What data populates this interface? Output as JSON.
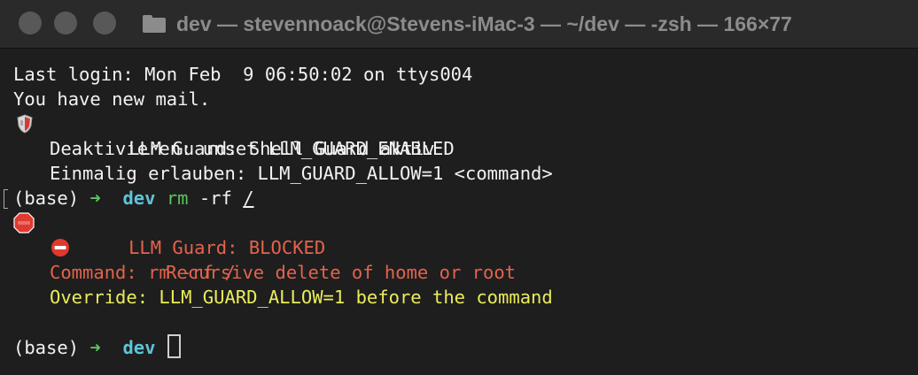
{
  "window": {
    "title": "dev — stevennoack@Stevens-iMac-3 — ~/dev — -zsh — 166×77",
    "controls": [
      "close",
      "minimize",
      "zoom"
    ],
    "title_icon": "folder-icon"
  },
  "colors": {
    "background": "#1e1e1e",
    "titlebar": "#2a2a2a",
    "text": "#f2f2f2",
    "error": "#e5634c",
    "warning": "#eaec5a",
    "prompt_arrow": "#5cc65c",
    "directory": "#5ec4d9"
  },
  "terminal": {
    "last_login": "Last login: Mon Feb  9 06:50:02 on ttys004",
    "mail": "You have new mail.",
    "guard_banner": {
      "icon": "shield-icon",
      "line1": "LLM Guard: Shell Guard aktiv",
      "line2": "Deaktivieren: unset LLM_GUARD_ENABLED",
      "line3": "Einmalig erlauben: LLM_GUARD_ALLOW=1 <command>"
    },
    "prompt1": {
      "env": "(base)",
      "arrow": "➜",
      "dir": "dev",
      "cmd": "rm",
      "args": "-rf",
      "target": "/"
    },
    "blocked": {
      "stop_icon": "stop-sign-icon",
      "title": "LLM Guard: BLOCKED",
      "no_entry_icon": "no-entry-icon",
      "reason": "Recursive delete of home or root",
      "command": "Command: rm -rf /",
      "override": "Override: LLM_GUARD_ALLOW=1 before the command"
    },
    "prompt2": {
      "env": "(base)",
      "arrow": "➜",
      "dir": "dev"
    }
  }
}
